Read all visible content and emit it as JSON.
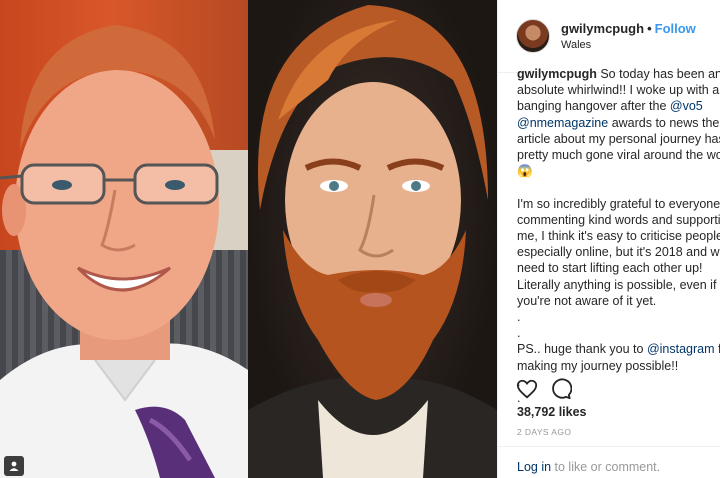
{
  "post": {
    "username": "gwilymcpugh",
    "separator": "•",
    "follow_label": "Follow",
    "location": "Wales"
  },
  "caption": {
    "username": "gwilymcpugh",
    "part1": " So today has been an absolute whirlwind!! I woke up with a banging hangover after the ",
    "mention1": "@vo5",
    "part2": " ",
    "mention2": "@nmemagazine",
    "part3": " awards to news the article about my personal journey has pretty much gone viral around the world 😱\n\nI'm so incredibly grateful to everyone commenting kind words and supporting me, I think it's easy to criticise people, especially online, but it's 2018 and we need to start lifting each other up! Literally anything is possible, even if you're not aware of it yet.\n.\n.\nPS.. huge thank you to ",
    "mention3": "@instagram",
    "part4": " for making my journey possible!!\n.\n."
  },
  "actions": {
    "like_icon": "heart-outline-icon",
    "comment_icon": "speech-bubble-icon"
  },
  "likes": "38,792 likes",
  "timestamp": "2 DAYS AGO",
  "login": {
    "link": "Log in",
    "rest": " to like or comment."
  },
  "colors": {
    "link_blue": "#3897f0",
    "mention_blue": "#003569",
    "muted_gray": "#999999",
    "border": "#efefef"
  }
}
